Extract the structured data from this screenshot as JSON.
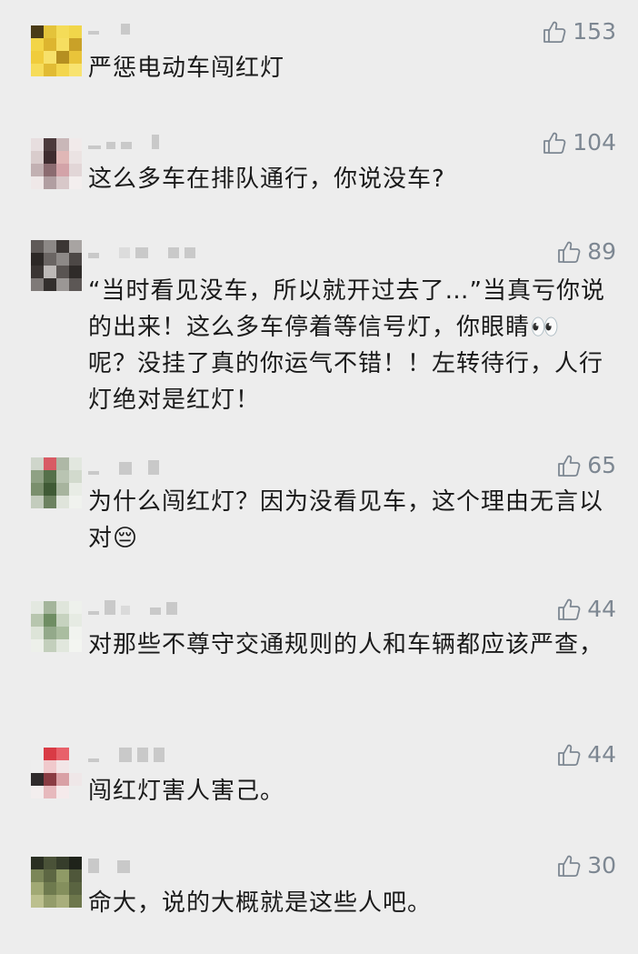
{
  "comments": [
    {
      "likes": "153",
      "text": "严惩电动车闯红灯"
    },
    {
      "likes": "104",
      "text": "这么多车在排队通行，你说没车?"
    },
    {
      "likes": "89",
      "text": "“当时看见没车，所以就开过去了…”当真亏你说的出来！这么多车停着等信号灯，你眼睛👀呢？没挂了真的你运气不错！！左转待行，人行灯绝对是红灯！"
    },
    {
      "likes": "65",
      "text": "为什么闯红灯？因为没看见车，这个理由无言以对😔"
    },
    {
      "likes": "44",
      "text": "对那些不尊守交通规则的人和车辆都应该严查，"
    },
    {
      "likes": "44",
      "text": "闯红灯害人害己。"
    },
    {
      "likes": "30",
      "text": "命大，说的大概就是这些人吧。"
    }
  ],
  "colors": {
    "background": "#ededed",
    "text": "#1a1a1a",
    "like": "#7d8792",
    "nickname_blur": "#c9c9c9"
  },
  "icons": {
    "like": "thumbs-up-icon",
    "avatar": "pixelated-avatar"
  }
}
